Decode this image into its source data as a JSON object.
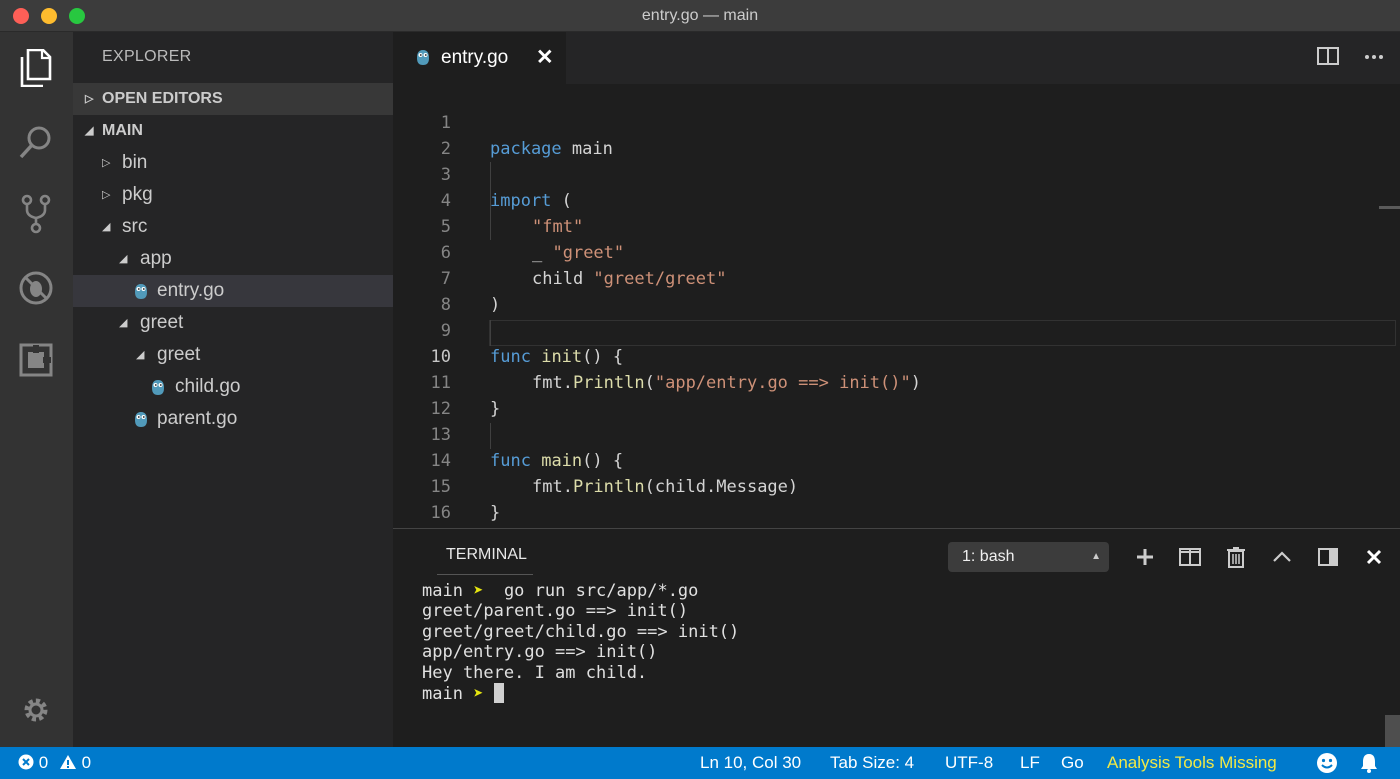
{
  "window": {
    "title": "entry.go — main"
  },
  "sidebar": {
    "title": "EXPLORER",
    "sections": {
      "open_editors": "OPEN EDITORS",
      "folder": "MAIN"
    },
    "tree": [
      {
        "label": "bin",
        "type": "folder",
        "expanded": false
      },
      {
        "label": "pkg",
        "type": "folder",
        "expanded": false
      },
      {
        "label": "src",
        "type": "folder",
        "expanded": true
      },
      {
        "label": "app",
        "type": "folder",
        "expanded": true
      },
      {
        "label": "entry.go",
        "type": "go-file",
        "selected": true
      },
      {
        "label": "greet",
        "type": "folder",
        "expanded": true
      },
      {
        "label": "greet",
        "type": "folder",
        "expanded": true
      },
      {
        "label": "child.go",
        "type": "go-file"
      },
      {
        "label": "parent.go",
        "type": "go-file"
      }
    ]
  },
  "editor": {
    "tab": {
      "label": "entry.go",
      "close": "✕"
    },
    "line_numbers": [
      "1",
      "2",
      "3",
      "4",
      "5",
      "6",
      "7",
      "8",
      "9",
      "10",
      "11",
      "12",
      "13",
      "14",
      "15",
      "16"
    ],
    "code": {
      "l1_kw": "package",
      "l1_rest": " main",
      "l3_kw": "import",
      "l3_rest": " (",
      "l4_str": "\"fmt\"",
      "l5_pre": "_ ",
      "l5_str": "\"greet\"",
      "l6_pre": "child ",
      "l6_str": "\"greet/greet\"",
      "l7": ")",
      "l9_kw": "func",
      "l9_fn": "init",
      "l9_rest": "() {",
      "l10_pre": "fmt.",
      "l10_fn": "Println",
      "l10_open": "(",
      "l10_str": "\"app/entry.go ==> init()\"",
      "l10_close": ")",
      "l11": "}",
      "l13_kw": "func",
      "l13_fn": "main",
      "l13_rest": "() {",
      "l14_pre": "fmt.",
      "l14_fn": "Println",
      "l14_rest": "(child.Message)",
      "l15": "}"
    }
  },
  "panel": {
    "title": "TERMINAL",
    "terminal_select": "1: bash",
    "lines": [
      "go run src/app/*.go",
      "greet/parent.go ==> init()",
      "greet/greet/child.go ==> init()",
      "app/entry.go ==> init()",
      "Hey there. I am child."
    ],
    "prompt_dir": "main",
    "prompt_arrow": "➤"
  },
  "statusbar": {
    "errors": "0",
    "warnings": "0",
    "position": "Ln 10, Col 30",
    "tab_size": "Tab Size: 4",
    "encoding": "UTF-8",
    "eol": "LF",
    "language": "Go",
    "analysis": "Analysis Tools Missing"
  },
  "colors": {
    "accent": "#007acc",
    "keyword": "#569cd6",
    "string": "#ce9178",
    "function": "#dcdcaa",
    "warning_text": "#f3e945"
  }
}
